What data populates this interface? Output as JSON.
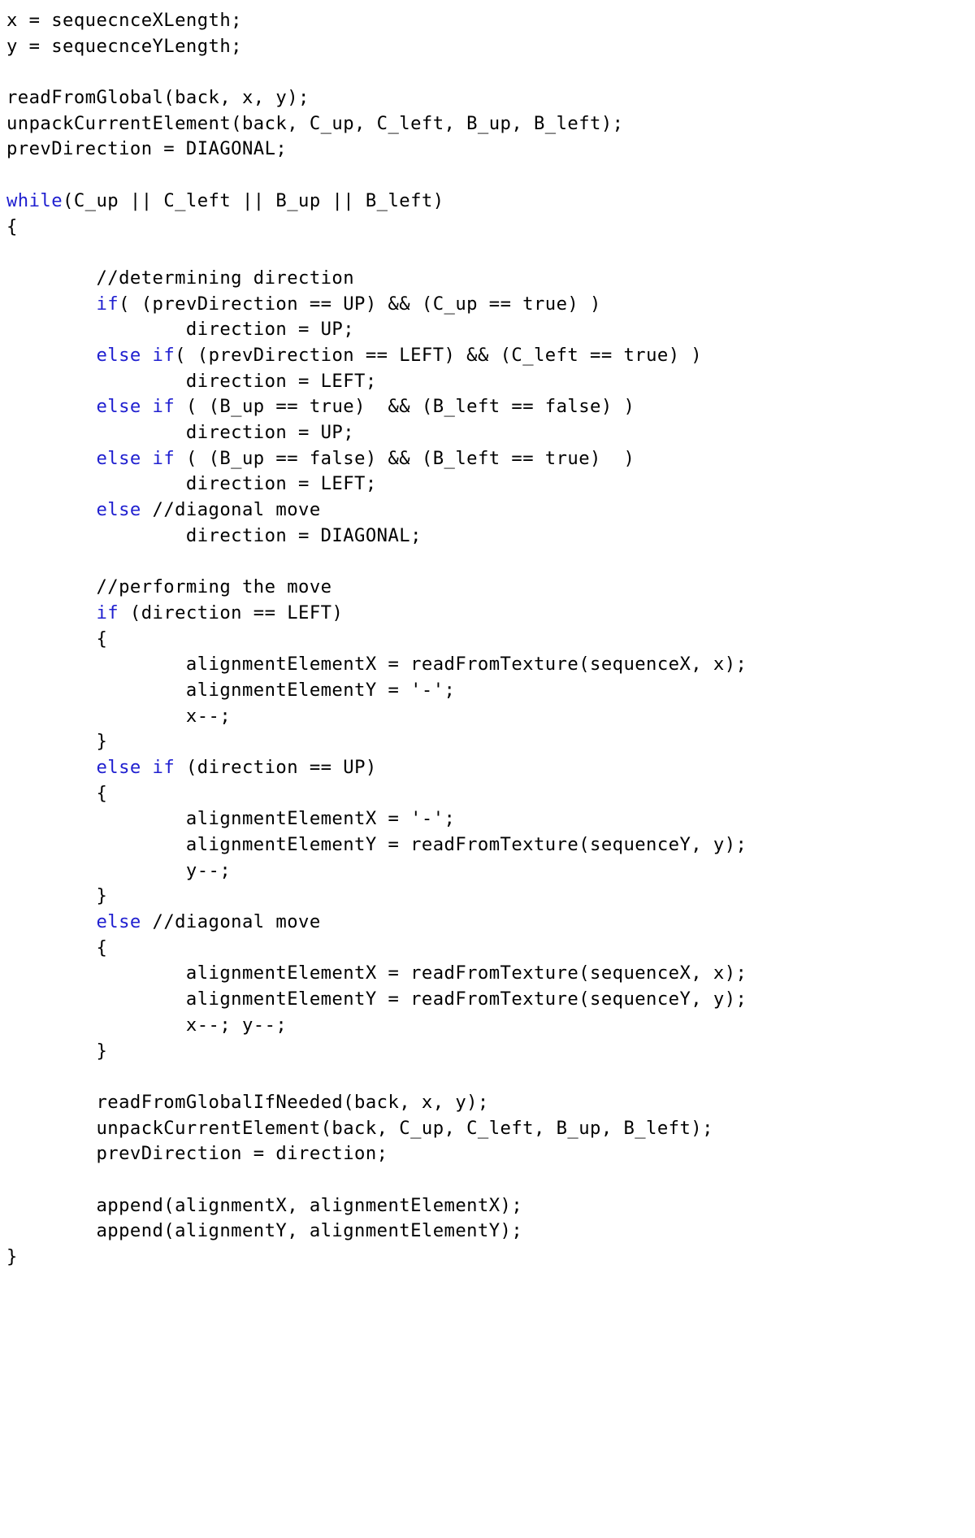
{
  "document": {
    "kind": "code-listing",
    "language": "C-like pseudocode",
    "background_color": "#ffffff",
    "text_color": "#000000",
    "keyword_color": "#2020d0",
    "indent_unit": "        "
  },
  "code": {
    "lines": [
      {
        "id": 1,
        "indent": 0,
        "text": "x = sequecnceXLength;",
        "segments": [
          {
            "type": "text",
            "value": "x = sequecnceXLength;"
          }
        ]
      },
      {
        "id": 2,
        "indent": 0,
        "text": "y = sequecnceYLength;",
        "segments": [
          {
            "type": "text",
            "value": "y = sequecnceYLength;"
          }
        ]
      },
      {
        "id": 3,
        "indent": 0,
        "text": "",
        "segments": []
      },
      {
        "id": 4,
        "indent": 0,
        "text": "readFromGlobal(back, x, y);",
        "segments": [
          {
            "type": "text",
            "value": "readFromGlobal(back, x, y);"
          }
        ]
      },
      {
        "id": 5,
        "indent": 0,
        "text": "unpackCurrentElement(back, C_up, C_left, B_up, B_left);",
        "segments": [
          {
            "type": "text",
            "value": "unpackCurrentElement(back, C_up, C_left, B_up, B_left);"
          }
        ]
      },
      {
        "id": 6,
        "indent": 0,
        "text": "prevDirection = DIAGONAL;",
        "segments": [
          {
            "type": "text",
            "value": "prevDirection = DIAGONAL;"
          }
        ]
      },
      {
        "id": 7,
        "indent": 0,
        "text": "",
        "segments": []
      },
      {
        "id": 8,
        "indent": 0,
        "text": "while(C_up || C_left || B_up || B_left)",
        "segments": [
          {
            "type": "keyword",
            "value": "while"
          },
          {
            "type": "text",
            "value": "(C_up || C_left || B_up || B_left)"
          }
        ]
      },
      {
        "id": 9,
        "indent": 0,
        "text": "{",
        "segments": [
          {
            "type": "text",
            "value": "{"
          }
        ]
      },
      {
        "id": 10,
        "indent": 0,
        "text": "",
        "segments": []
      },
      {
        "id": 11,
        "indent": 1,
        "text": "        //determining direction",
        "segments": [
          {
            "type": "text",
            "value": "        //determining direction"
          }
        ]
      },
      {
        "id": 12,
        "indent": 1,
        "text": "        if( (prevDirection == UP) && (C_up == true) )",
        "segments": [
          {
            "type": "text",
            "value": "        "
          },
          {
            "type": "keyword",
            "value": "if"
          },
          {
            "type": "text",
            "value": "( (prevDirection == UP) && (C_up == true) )"
          }
        ]
      },
      {
        "id": 13,
        "indent": 2,
        "text": "                direction = UP;",
        "segments": [
          {
            "type": "text",
            "value": "                direction = UP;"
          }
        ]
      },
      {
        "id": 14,
        "indent": 1,
        "text": "        else if( (prevDirection == LEFT) && (C_left == true) )",
        "segments": [
          {
            "type": "text",
            "value": "        "
          },
          {
            "type": "keyword",
            "value": "else"
          },
          {
            "type": "text",
            "value": " "
          },
          {
            "type": "keyword",
            "value": "if"
          },
          {
            "type": "text",
            "value": "( (prevDirection == LEFT) && (C_left == true) )"
          }
        ]
      },
      {
        "id": 15,
        "indent": 2,
        "text": "                direction = LEFT;",
        "segments": [
          {
            "type": "text",
            "value": "                direction = LEFT;"
          }
        ]
      },
      {
        "id": 16,
        "indent": 1,
        "text": "        else if ( (B_up == true)  && (B_left == false) )",
        "segments": [
          {
            "type": "text",
            "value": "        "
          },
          {
            "type": "keyword",
            "value": "else"
          },
          {
            "type": "text",
            "value": " "
          },
          {
            "type": "keyword",
            "value": "if"
          },
          {
            "type": "text",
            "value": " ( (B_up == true)  && (B_left == false) )"
          }
        ]
      },
      {
        "id": 17,
        "indent": 2,
        "text": "                direction = UP;",
        "segments": [
          {
            "type": "text",
            "value": "                direction = UP;"
          }
        ]
      },
      {
        "id": 18,
        "indent": 1,
        "text": "        else if ( (B_up == false) && (B_left == true)  )",
        "segments": [
          {
            "type": "text",
            "value": "        "
          },
          {
            "type": "keyword",
            "value": "else"
          },
          {
            "type": "text",
            "value": " "
          },
          {
            "type": "keyword",
            "value": "if"
          },
          {
            "type": "text",
            "value": " ( (B_up == false) && (B_left == true)  )"
          }
        ]
      },
      {
        "id": 19,
        "indent": 2,
        "text": "                direction = LEFT;",
        "segments": [
          {
            "type": "text",
            "value": "                direction = LEFT;"
          }
        ]
      },
      {
        "id": 20,
        "indent": 1,
        "text": "        else //diagonal move",
        "segments": [
          {
            "type": "text",
            "value": "        "
          },
          {
            "type": "keyword",
            "value": "else"
          },
          {
            "type": "text",
            "value": " //diagonal move"
          }
        ]
      },
      {
        "id": 21,
        "indent": 2,
        "text": "                direction = DIAGONAL;",
        "segments": [
          {
            "type": "text",
            "value": "                direction = DIAGONAL;"
          }
        ]
      },
      {
        "id": 22,
        "indent": 0,
        "text": "",
        "segments": []
      },
      {
        "id": 23,
        "indent": 1,
        "text": "        //performing the move",
        "segments": [
          {
            "type": "text",
            "value": "        //performing the move"
          }
        ]
      },
      {
        "id": 24,
        "indent": 1,
        "text": "        if (direction == LEFT)",
        "segments": [
          {
            "type": "text",
            "value": "        "
          },
          {
            "type": "keyword",
            "value": "if"
          },
          {
            "type": "text",
            "value": " (direction == LEFT)"
          }
        ]
      },
      {
        "id": 25,
        "indent": 1,
        "text": "        {",
        "segments": [
          {
            "type": "text",
            "value": "        {"
          }
        ]
      },
      {
        "id": 26,
        "indent": 2,
        "text": "                alignmentElementX = readFromTexture(sequenceX, x);",
        "segments": [
          {
            "type": "text",
            "value": "                alignmentElementX = readFromTexture(sequenceX, x);"
          }
        ]
      },
      {
        "id": 27,
        "indent": 2,
        "text": "                alignmentElementY = '-';",
        "segments": [
          {
            "type": "text",
            "value": "                alignmentElementY = '-';"
          }
        ]
      },
      {
        "id": 28,
        "indent": 2,
        "text": "                x--;",
        "segments": [
          {
            "type": "text",
            "value": "                x--;"
          }
        ]
      },
      {
        "id": 29,
        "indent": 1,
        "text": "        }",
        "segments": [
          {
            "type": "text",
            "value": "        }"
          }
        ]
      },
      {
        "id": 30,
        "indent": 1,
        "text": "        else if (direction == UP)",
        "segments": [
          {
            "type": "text",
            "value": "        "
          },
          {
            "type": "keyword",
            "value": "else"
          },
          {
            "type": "text",
            "value": " "
          },
          {
            "type": "keyword",
            "value": "if"
          },
          {
            "type": "text",
            "value": " (direction == UP)"
          }
        ]
      },
      {
        "id": 31,
        "indent": 1,
        "text": "        {",
        "segments": [
          {
            "type": "text",
            "value": "        {"
          }
        ]
      },
      {
        "id": 32,
        "indent": 2,
        "text": "                alignmentElementX = '-';",
        "segments": [
          {
            "type": "text",
            "value": "                alignmentElementX = '-';"
          }
        ]
      },
      {
        "id": 33,
        "indent": 2,
        "text": "                alignmentElementY = readFromTexture(sequenceY, y);",
        "segments": [
          {
            "type": "text",
            "value": "                alignmentElementY = readFromTexture(sequenceY, y);"
          }
        ]
      },
      {
        "id": 34,
        "indent": 2,
        "text": "                y--;",
        "segments": [
          {
            "type": "text",
            "value": "                y--;"
          }
        ]
      },
      {
        "id": 35,
        "indent": 1,
        "text": "        }",
        "segments": [
          {
            "type": "text",
            "value": "        }"
          }
        ]
      },
      {
        "id": 36,
        "indent": 1,
        "text": "        else //diagonal move",
        "segments": [
          {
            "type": "text",
            "value": "        "
          },
          {
            "type": "keyword",
            "value": "else"
          },
          {
            "type": "text",
            "value": " //diagonal move"
          }
        ]
      },
      {
        "id": 37,
        "indent": 1,
        "text": "        {",
        "segments": [
          {
            "type": "text",
            "value": "        {"
          }
        ]
      },
      {
        "id": 38,
        "indent": 2,
        "text": "                alignmentElementX = readFromTexture(sequenceX, x);",
        "segments": [
          {
            "type": "text",
            "value": "                alignmentElementX = readFromTexture(sequenceX, x);"
          }
        ]
      },
      {
        "id": 39,
        "indent": 2,
        "text": "                alignmentElementY = readFromTexture(sequenceY, y);",
        "segments": [
          {
            "type": "text",
            "value": "                alignmentElementY = readFromTexture(sequenceY, y);"
          }
        ]
      },
      {
        "id": 40,
        "indent": 2,
        "text": "                x--; y--;",
        "segments": [
          {
            "type": "text",
            "value": "                x--; y--;"
          }
        ]
      },
      {
        "id": 41,
        "indent": 1,
        "text": "        }",
        "segments": [
          {
            "type": "text",
            "value": "        }"
          }
        ]
      },
      {
        "id": 42,
        "indent": 0,
        "text": "",
        "segments": []
      },
      {
        "id": 43,
        "indent": 1,
        "text": "        readFromGlobalIfNeeded(back, x, y);",
        "segments": [
          {
            "type": "text",
            "value": "        readFromGlobalIfNeeded(back, x, y);"
          }
        ]
      },
      {
        "id": 44,
        "indent": 1,
        "text": "        unpackCurrentElement(back, C_up, C_left, B_up, B_left);",
        "segments": [
          {
            "type": "text",
            "value": "        unpackCurrentElement(back, C_up, C_left, B_up, B_left);"
          }
        ]
      },
      {
        "id": 45,
        "indent": 1,
        "text": "        prevDirection = direction;",
        "segments": [
          {
            "type": "text",
            "value": "        prevDirection = direction;"
          }
        ]
      },
      {
        "id": 46,
        "indent": 0,
        "text": "",
        "segments": []
      },
      {
        "id": 47,
        "indent": 1,
        "text": "        append(alignmentX, alignmentElementX);",
        "segments": [
          {
            "type": "text",
            "value": "        append(alignmentX, alignmentElementX);"
          }
        ]
      },
      {
        "id": 48,
        "indent": 1,
        "text": "        append(alignmentY, alignmentElementY);",
        "segments": [
          {
            "type": "text",
            "value": "        append(alignmentY, alignmentElementY);"
          }
        ]
      },
      {
        "id": 49,
        "indent": 0,
        "text": "}",
        "segments": [
          {
            "type": "text",
            "value": "}"
          }
        ]
      }
    ]
  }
}
